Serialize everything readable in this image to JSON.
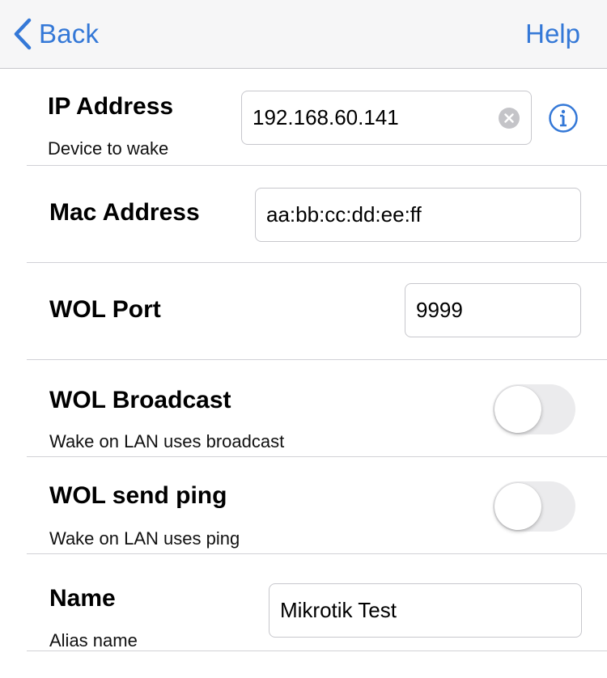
{
  "nav": {
    "back_label": "Back",
    "help_label": "Help"
  },
  "ip": {
    "title": "IP Address",
    "subtitle": "Device to wake",
    "value": "192.168.60.141"
  },
  "mac": {
    "title": "Mac Address",
    "value": "aa:bb:cc:dd:ee:ff"
  },
  "port": {
    "title": "WOL Port",
    "value": "9999"
  },
  "broadcast": {
    "title": "WOL Broadcast",
    "subtitle": "Wake on LAN uses broadcast",
    "enabled": false
  },
  "ping": {
    "title": "WOL send ping",
    "subtitle": "Wake on LAN uses ping",
    "enabled": false
  },
  "name": {
    "title": "Name",
    "subtitle": "Alias name",
    "value": "Mikrotik Test"
  },
  "colors": {
    "accent": "#3478d7",
    "toggle_off": "#ebebed",
    "separator": "#d1d1d6"
  }
}
